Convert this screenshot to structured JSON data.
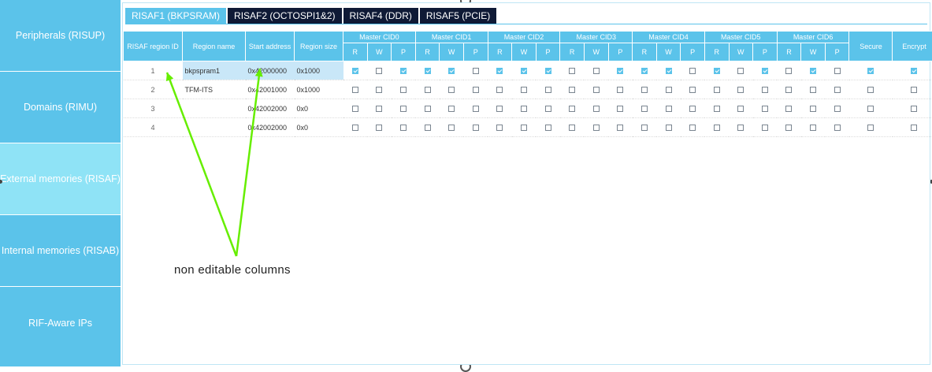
{
  "sidebar": {
    "items": [
      {
        "label": "Peripherals (RISUP)",
        "active": false
      },
      {
        "label": "Domains (RIMU)",
        "active": false
      },
      {
        "label": "External memories (RISAF)",
        "active": true
      },
      {
        "label": "Internal memories (RISAB)",
        "active": false
      },
      {
        "label": "RIF-Aware IPs",
        "active": false
      }
    ]
  },
  "tabs": [
    {
      "label": "RISAF1 (BKPSRAM)",
      "active": true
    },
    {
      "label": "RISAF2 (OCTOSPI1&2)",
      "active": false
    },
    {
      "label": "RISAF4 (DDR)",
      "active": false
    },
    {
      "label": "RISAF5 (PCIE)",
      "active": false
    }
  ],
  "table": {
    "headers": {
      "region_id": "RISAF region ID",
      "region_name": "Region name",
      "start_address": "Start address",
      "region_size": "Region size",
      "secure": "Secure",
      "encrypt": "Encrypt"
    },
    "cid_groups": [
      "Master CID0",
      "Master CID1",
      "Master CID2",
      "Master CID3",
      "Master CID4",
      "Master CID5",
      "Master CID6"
    ],
    "rwp": [
      "R",
      "W",
      "P"
    ],
    "rows": [
      {
        "id": "1",
        "name": "bkpspram1",
        "start": "0x42000000",
        "size": "0x1000",
        "cids": [
          [
            1,
            0,
            1
          ],
          [
            1,
            1,
            0
          ],
          [
            1,
            1,
            1
          ],
          [
            0,
            0,
            1
          ],
          [
            1,
            1,
            0
          ],
          [
            1,
            0,
            1
          ],
          [
            0,
            1,
            0
          ]
        ],
        "secure": 1,
        "encrypt": 1,
        "highlight": true
      },
      {
        "id": "2",
        "name": "TFM-ITS",
        "start": "0x42001000",
        "size": "0x1000",
        "cids": [
          [
            0,
            0,
            0
          ],
          [
            0,
            0,
            0
          ],
          [
            0,
            0,
            0
          ],
          [
            0,
            0,
            0
          ],
          [
            0,
            0,
            0
          ],
          [
            0,
            0,
            0
          ],
          [
            0,
            0,
            0
          ]
        ],
        "secure": 0,
        "encrypt": 0,
        "highlight": false
      },
      {
        "id": "3",
        "name": "",
        "start": "0x42002000",
        "size": "0x0",
        "cids": [
          [
            0,
            0,
            0
          ],
          [
            0,
            0,
            0
          ],
          [
            0,
            0,
            0
          ],
          [
            0,
            0,
            0
          ],
          [
            0,
            0,
            0
          ],
          [
            0,
            0,
            0
          ],
          [
            0,
            0,
            0
          ]
        ],
        "secure": 0,
        "encrypt": 0,
        "highlight": false
      },
      {
        "id": "4",
        "name": "",
        "start": "0x42002000",
        "size": "0x0",
        "cids": [
          [
            0,
            0,
            0
          ],
          [
            0,
            0,
            0
          ],
          [
            0,
            0,
            0
          ],
          [
            0,
            0,
            0
          ],
          [
            0,
            0,
            0
          ],
          [
            0,
            0,
            0
          ],
          [
            0,
            0,
            0
          ]
        ],
        "secure": 0,
        "encrypt": 0,
        "highlight": false
      }
    ]
  },
  "annotation": {
    "text": "non editable columns",
    "arrow_color": "#66ee00"
  },
  "colors": {
    "accent": "#5bc3ea",
    "active_sidebar": "#8fe3f6",
    "dark_tab": "#0f1a36",
    "row_highlight": "#c9e7f8"
  }
}
